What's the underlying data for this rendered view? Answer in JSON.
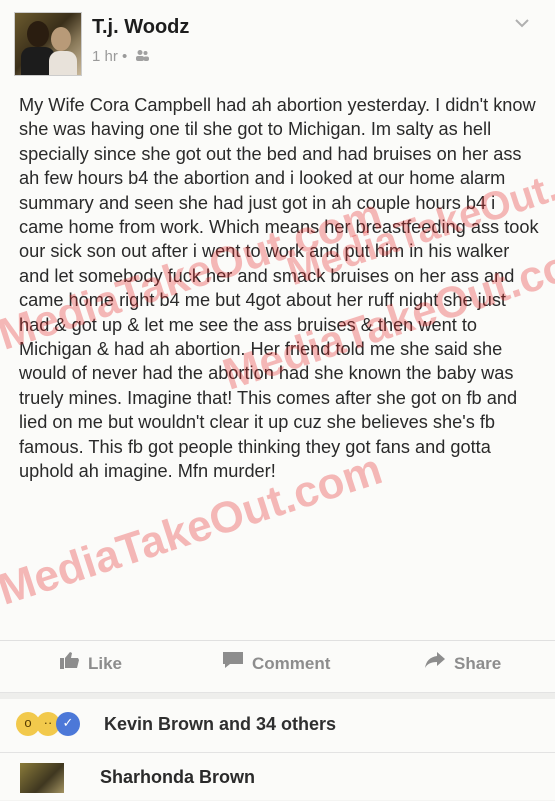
{
  "post": {
    "author": "T.j. Woodz",
    "time": "1 hr",
    "dot": "•",
    "audience_icon": "friends-icon",
    "menu_icon": "chevron-down-icon",
    "body": "My Wife Cora Campbell had ah abortion yesterday. I didn't know she was having one til she got to Michigan. Im salty as hell specially since she got out the bed and had bruises on her ass ah few hours b4 the abortion and i looked at our home alarm summary and seen she had just got in ah couple hours b4 i came home from work. Which means her breastfeeding ass took our sick son out after i went to work and put him in his walker and let somebody fuck her and smack bruises on her ass and came home right b4 me but 4got about her ruff night she just had & got up & let me see the ass bruises & then went to Michigan & had ah abortion. Her friend told me she said she would of never had the abortion had she known the baby was truely mines. Imagine that! This comes after she got on fb and lied on me but wouldn't clear it up cuz she believes she's fb famous. This fb got people thinking they got fans and gotta uphold ah imagine. Mfn murder!"
  },
  "watermark": "MediaTakeOut.com",
  "actions": {
    "like": "Like",
    "comment": "Comment",
    "share": "Share"
  },
  "reactions": {
    "summary": "Kevin Brown and 34 others",
    "types": [
      "wow",
      "sad",
      "like"
    ]
  },
  "comment": {
    "author": "Sharhonda Brown"
  },
  "colors": {
    "background": "#fbfbf9",
    "text": "#2a2a2a",
    "muted": "#8d8d8d",
    "watermark": "#e62828",
    "like_blue": "#4c78d8"
  }
}
